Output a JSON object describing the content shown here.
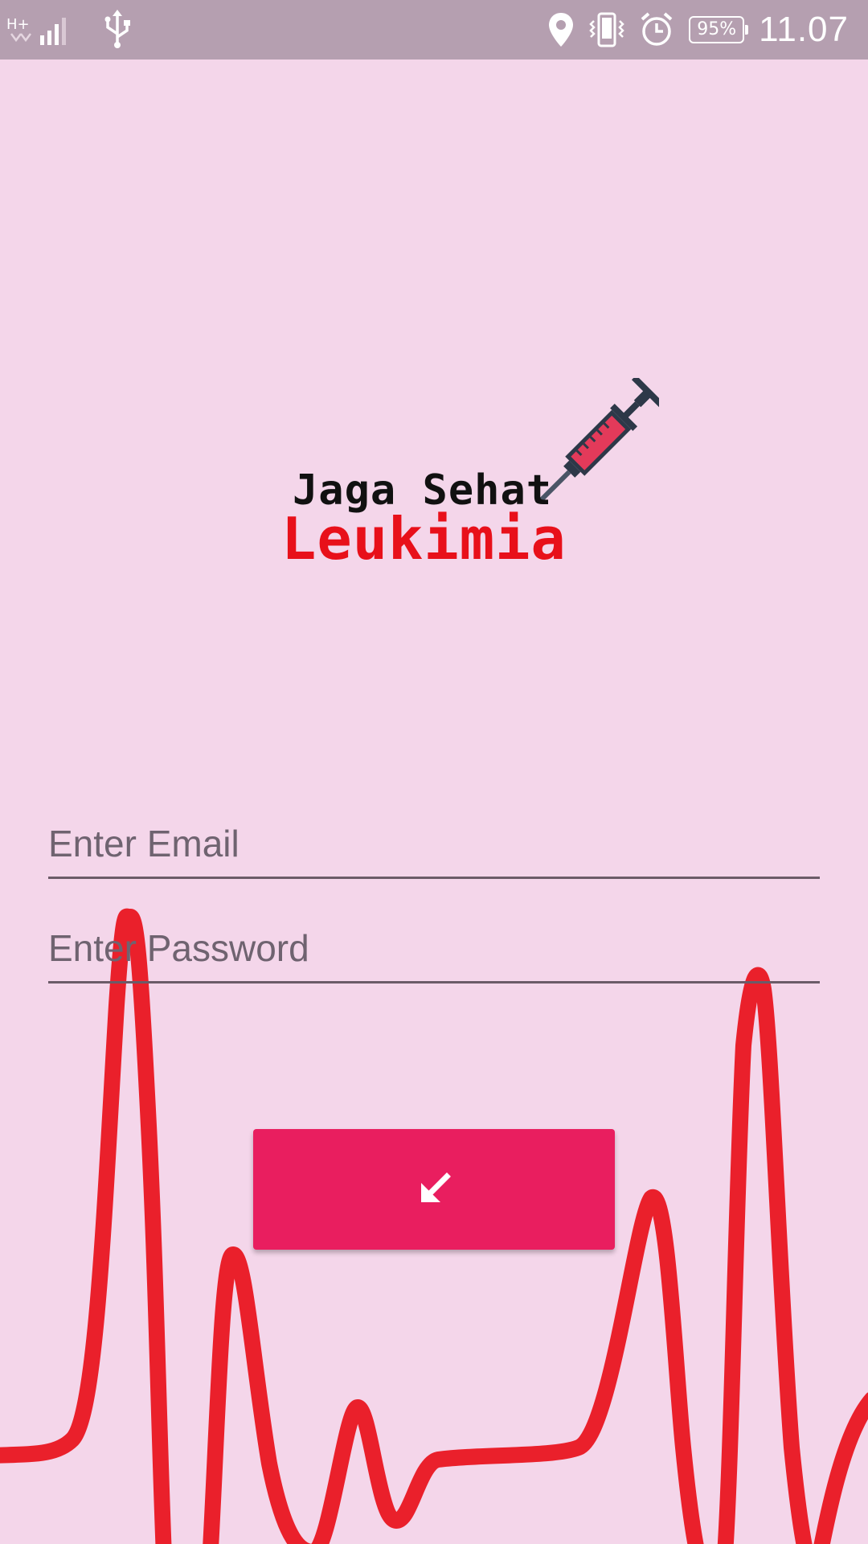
{
  "status_bar": {
    "network_type": "H+",
    "sim_slot": "2",
    "battery": "95%",
    "time": "11.07",
    "icons": [
      "signal-icon",
      "usb-icon",
      "location-icon",
      "vibrate-icon",
      "alarm-icon",
      "battery-icon"
    ]
  },
  "logo": {
    "line1": "Jaga Sehat",
    "line2": "Leukimia"
  },
  "form": {
    "email_placeholder": "Enter Email",
    "password_placeholder": "Enter Password",
    "login_icon": "arrow-down-left-icon"
  },
  "colors": {
    "background": "#f4d6ea",
    "status_bar": "#b59fb0",
    "accent": "#e91e5f",
    "heartbeat": "#e8101a",
    "logo_red": "#e8101a"
  }
}
